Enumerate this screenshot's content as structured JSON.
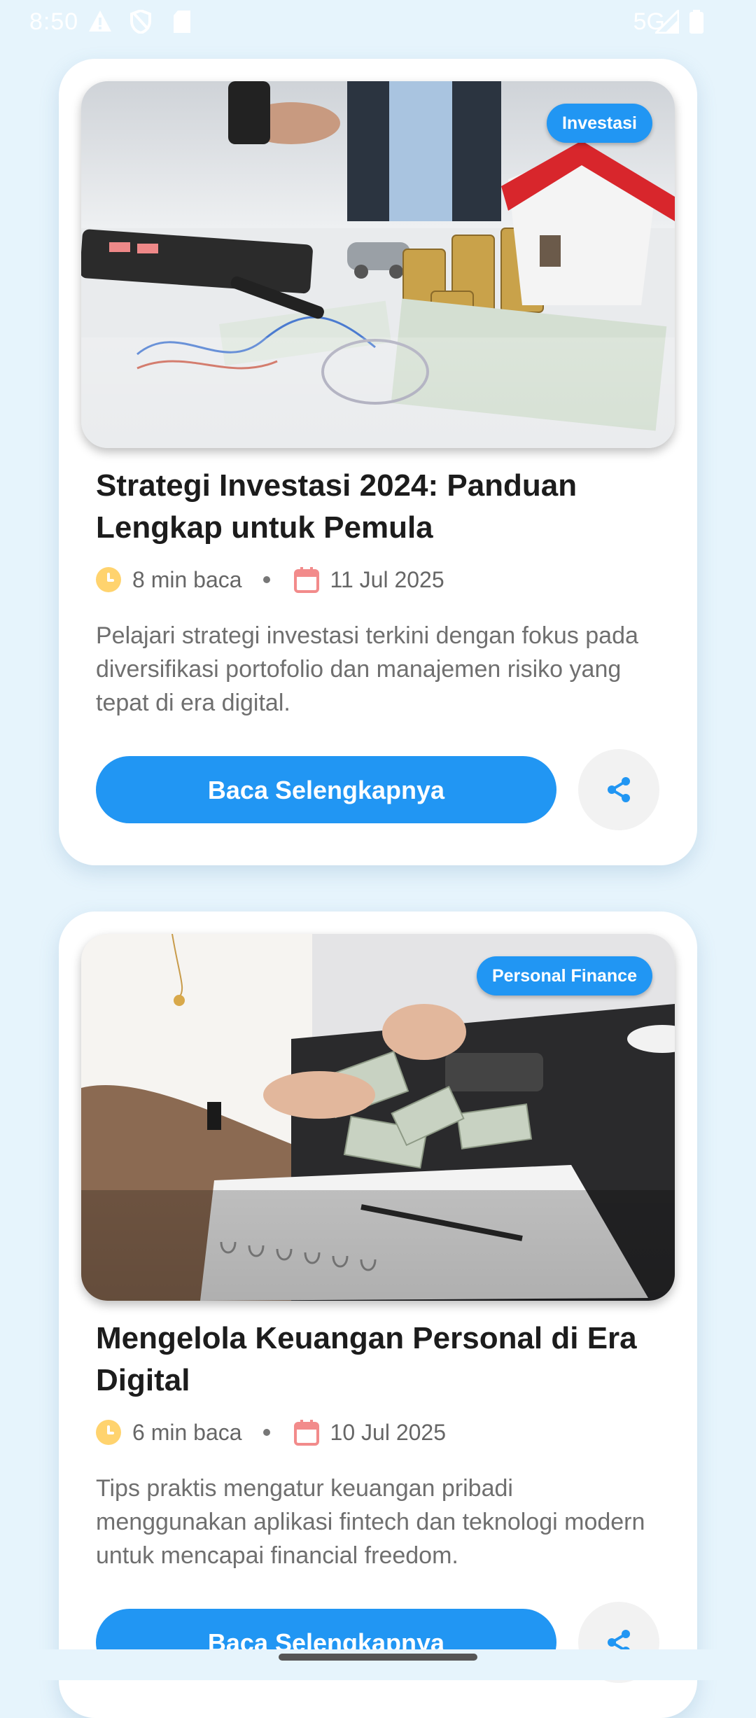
{
  "status_bar": {
    "time": "8:50",
    "network": "5G",
    "icons": [
      "warning-icon",
      "shield-icon",
      "sd-card-icon",
      "signal-icon",
      "battery-icon"
    ]
  },
  "articles": [
    {
      "category": "Investasi",
      "title": "Strategi Investasi 2024: Panduan Lengkap untuk Pemula",
      "read_time": "8 min baca",
      "date": "11 Jul 2025",
      "excerpt": "Pelajari strategi investasi terkini dengan fokus pada diversifikasi portofolio dan manajemen risiko yang tepat di era digital.",
      "cta": "Baca Selengkapnya"
    },
    {
      "category": "Personal Finance",
      "title": "Mengelola Keuangan Personal di Era Digital",
      "read_time": "6 min baca",
      "date": "10 Jul 2025",
      "excerpt": "Tips praktis mengatur keuangan pribadi menggunakan aplikasi fintech dan teknologi modern untuk mencapai financial freedom.",
      "cta": "Baca Selengkapnya"
    }
  ],
  "colors": {
    "background": "#e6f4fc",
    "accent": "#2196f3",
    "clock_icon": "#ffd36e",
    "calendar_icon": "#f28b8b"
  }
}
